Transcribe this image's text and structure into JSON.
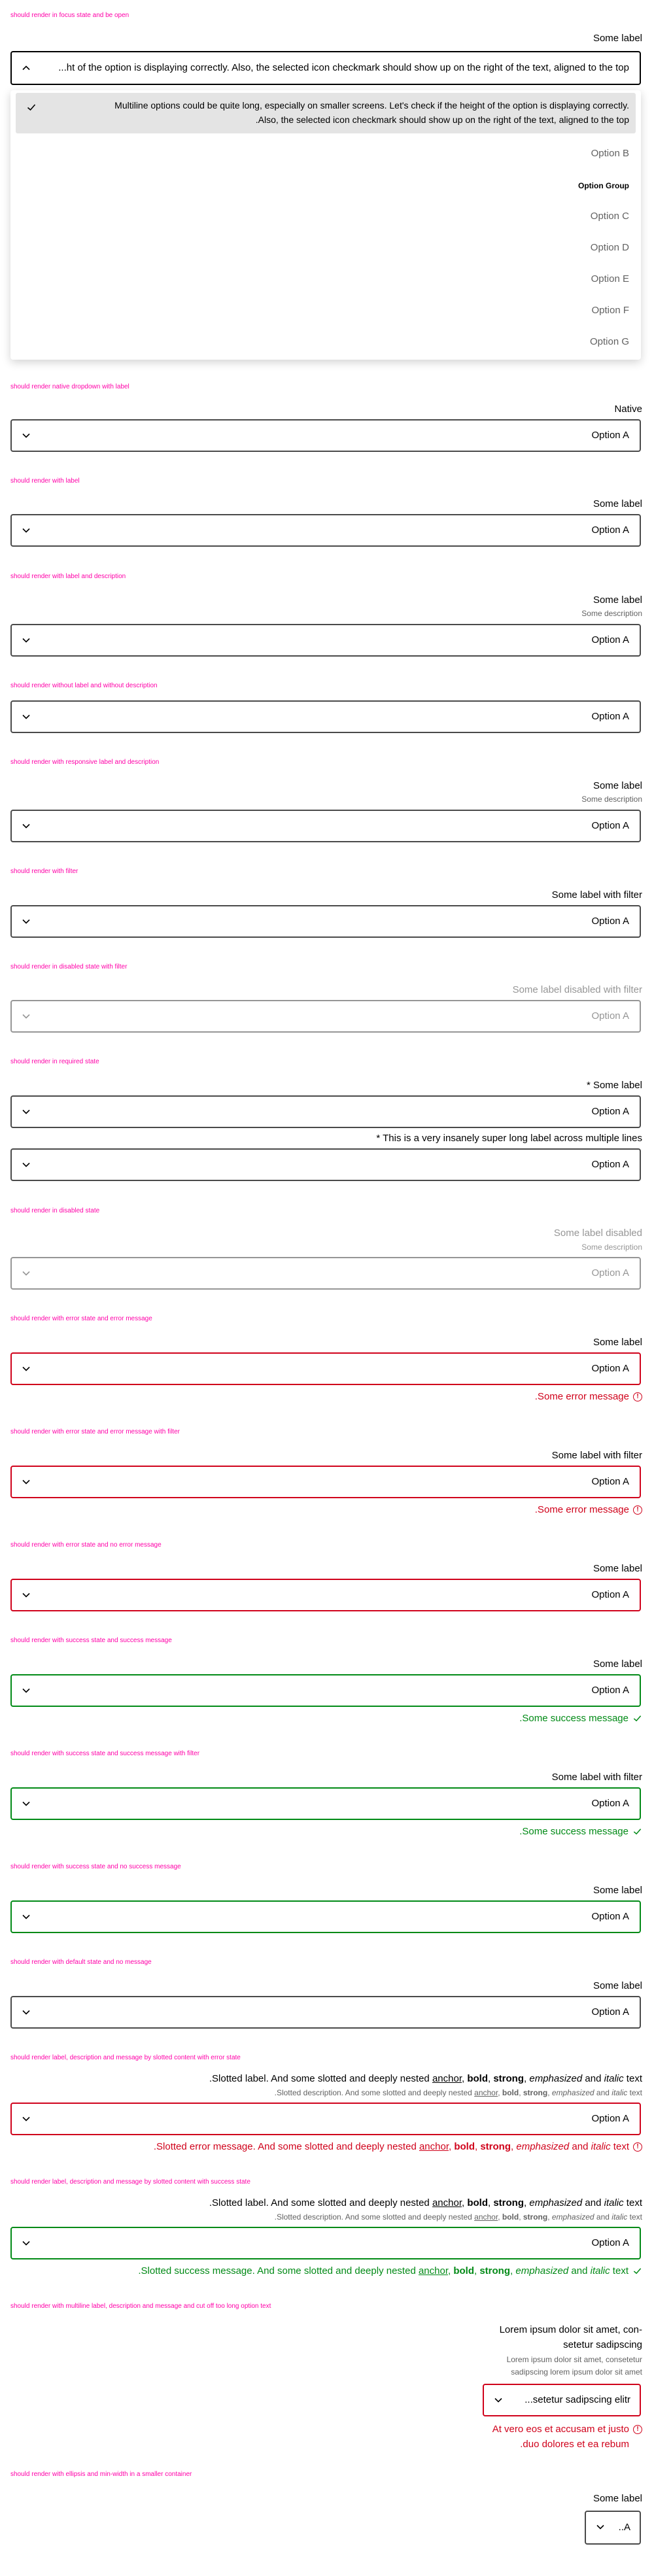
{
  "sections": {
    "s1": {
      "caption": "should render in focus state and be open",
      "label": "Some label",
      "value": "...ht of the option is displaying correctly. Also, the selected icon checkmark should show up on the right of the text, aligned to the top",
      "options": {
        "selected_line1": "Multiline options could be quite long, especially on smaller screens. Let's check if the height of the option is displaying correctly.",
        "selected_line2": ".Also, the selected icon checkmark should show up on the right of the text, aligned to the top",
        "b": "Option B",
        "group": "Option Group",
        "c": "Option C",
        "d": "Option D",
        "e": "Option E",
        "f": "Option F",
        "g": "Option G"
      }
    },
    "s2": {
      "caption": "should render native dropdown with label",
      "label": "Native",
      "value": "Option A"
    },
    "s3": {
      "caption": "should render with label",
      "label": "Some label",
      "value": "Option A"
    },
    "s4": {
      "caption": "should render with label and description",
      "label": "Some label",
      "description": "Some description",
      "value": "Option A"
    },
    "s5": {
      "caption": "should render without label and without description",
      "value": "Option A"
    },
    "s6": {
      "caption": "should render with responsive label and description",
      "label": "Some label",
      "description": "Some description",
      "value": "Option A"
    },
    "s7": {
      "caption": "should render with filter",
      "label": "Some label with filter",
      "value": "Option A"
    },
    "s8": {
      "caption": "should render in disabled state with filter",
      "label": "Some label disabled with filter",
      "value": "Option A"
    },
    "s9": {
      "caption": "should render in required state",
      "label": "* Some label",
      "value": "Option A",
      "label2": "* This is a very insanely super long label across multiple lines",
      "value2": "Option A"
    },
    "s10": {
      "caption": "should render in disabled state",
      "label": "Some label disabled",
      "description": "Some description",
      "value": "Option A"
    },
    "s11": {
      "caption": "should render with error state and error message",
      "label": "Some label",
      "value": "Option A",
      "message": ".Some error message"
    },
    "s12": {
      "caption": "should render with error state and error message with filter",
      "label": "Some label with filter",
      "value": "Option A",
      "message": ".Some error message"
    },
    "s13": {
      "caption": "should render with error state and no error message",
      "label": "Some label",
      "value": "Option A"
    },
    "s14": {
      "caption": "should render with success state and success message",
      "label": "Some label",
      "value": "Option A",
      "message": ".Some success message"
    },
    "s15": {
      "caption": "should render with success state and success message with filter",
      "label": "Some label with filter",
      "value": "Option A",
      "message": ".Some success message"
    },
    "s16": {
      "caption": "should render with success state and no success message",
      "label": "Some label",
      "value": "Option A"
    },
    "s17": {
      "caption": "should render with default state and no message",
      "label": "Some label",
      "value": "Option A"
    },
    "s18": {
      "caption": "should render label, description and message by slotted content with error state",
      "label_a": ".Slotted label. And some slotted and deeply nested ",
      "anchor": "anchor",
      "comma": ", ",
      "bold": "bold",
      "strong": "strong",
      "emph": "emphasized",
      "and": " and ",
      "italic": "italic",
      "text": " text",
      "desc_a": ".Slotted description. And some slotted and deeply nested ",
      "value": "Option A",
      "msg_a": ".Slotted error message. And some slotted and deeply nested "
    },
    "s19": {
      "caption": "should render label, description and message by slotted content with success state",
      "label_a": ".Slotted label. And some slotted and deeply nested ",
      "desc_a": ".Slotted description. And some slotted and deeply nested ",
      "value": "Option A",
      "msg_a": ".Slotted success message. And some slotted and deeply nested "
    },
    "s20": {
      "caption": "should render with multiline label, description and message and cut off too long option text",
      "label_line1": "Lorem ipsum dolor sit amet, con-",
      "label_line2": "setetur sadipscing",
      "desc_line1": "Lorem ipsum dolor sit amet, consetetur",
      "desc_line2": "sadipscing lorem ipsum dolor sit amet",
      "value": "...setetur sadipscing elitr",
      "msg_line1": "At vero eos et accusam et justo",
      "msg_line2": ".duo dolores et ea rebum"
    },
    "s21": {
      "caption": "should render with ellipsis and min-width in a smaller container",
      "label": "Some label",
      "value": "..A"
    }
  }
}
